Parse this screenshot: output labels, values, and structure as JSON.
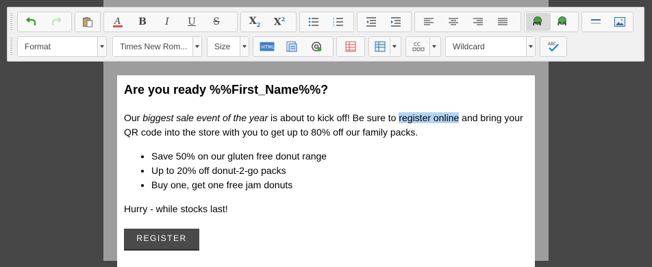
{
  "toolbar": {
    "format_label": "Format",
    "font_label": "Times New Rom...",
    "size_label": "Size",
    "wildcard_label": "Wildcard",
    "icons": {
      "undo": "undo-icon",
      "redo": "redo-icon",
      "paste": "paste-icon",
      "text_color": "text-color-icon",
      "bold": "B",
      "italic": "I",
      "underline": "U",
      "strike": "S",
      "subscript": "X",
      "superscript": "X"
    }
  },
  "doc": {
    "heading": "Are you ready %%First_Name%%?",
    "para1_a": "Our ",
    "para1_em": "biggest sale event of the year",
    "para1_b": " is about to kick off! Be sure to ",
    "para1_sel": "register online",
    "para1_c": " and bring your QR code into the store with you to get up to 80% off our family packs.",
    "list": [
      "Save 50% on our gluten free donut range",
      "Up to 20% off donut-2-go packs",
      "Buy one, get one free jam donuts"
    ],
    "closing": "Hurry - while stocks last!",
    "button_label": "REGISTER"
  },
  "colors": {
    "accent_red": "#d9534f",
    "link_blue": "#2f6fb0",
    "check_blue": "#1d7fd8",
    "selection": "#b3d4f5"
  }
}
